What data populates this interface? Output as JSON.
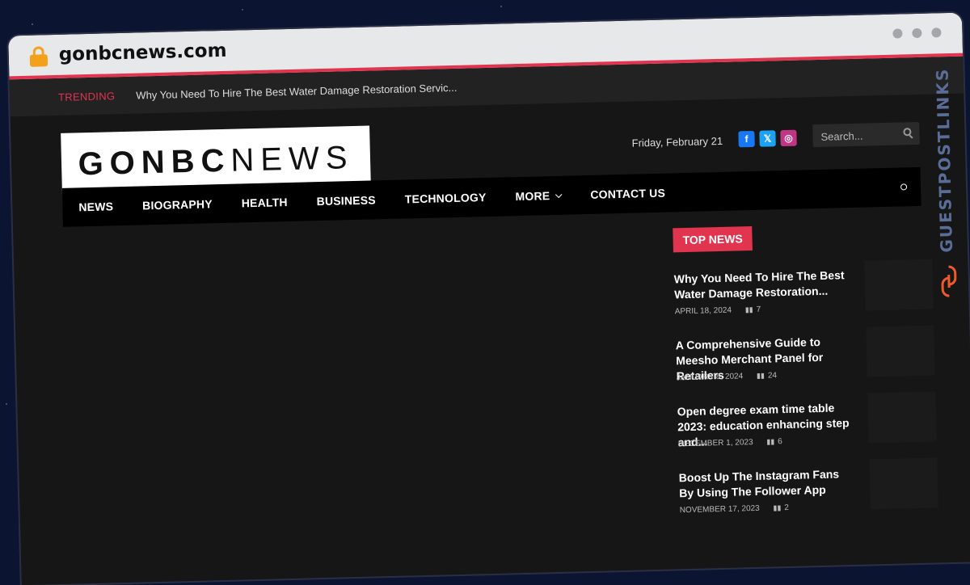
{
  "browser": {
    "url": "gonbcnews.com"
  },
  "trending": {
    "label": "TRENDING",
    "text": "Why You Need To Hire The Best Water Damage Restoration Servic..."
  },
  "header": {
    "logo_bold": "GONBC",
    "logo_light": "NEWS",
    "date": "Friday, February 21",
    "search_placeholder": "Search..."
  },
  "social": [
    {
      "name": "facebook-icon",
      "glyph": "f",
      "color": "#1877f2"
    },
    {
      "name": "x-icon",
      "glyph": "𝕏",
      "color": "#1da1f2"
    },
    {
      "name": "instagram-icon",
      "glyph": "◎",
      "color": "#c13584"
    }
  ],
  "nav": {
    "items": [
      "NEWS",
      "BIOGRAPHY",
      "HEALTH",
      "BUSINESS",
      "TECHNOLOGY",
      "MORE",
      "CONTACT US"
    ]
  },
  "sidebar": {
    "heading": "TOP NEWS",
    "posts": [
      {
        "title": "Why You Need To Hire The Best Water Damage Restoration...",
        "date": "APRIL 18, 2024",
        "views": "7"
      },
      {
        "title": "A Comprehensive Guide to Meesho Merchant Panel for Retailers",
        "date": "JANUARY 8, 2024",
        "views": "24"
      },
      {
        "title": "Open degree exam time table 2023: education enhancing step and...",
        "date": "DECEMBER 1, 2023",
        "views": "6"
      },
      {
        "title": "Boost Up The Instagram Fans By Using The Follower App",
        "date": "NOVEMBER 17, 2023",
        "views": "2"
      }
    ]
  },
  "watermark": {
    "text": "GUESTPOSTLINKS"
  },
  "colors": {
    "accent": "#e0344f",
    "background": "#161616"
  }
}
